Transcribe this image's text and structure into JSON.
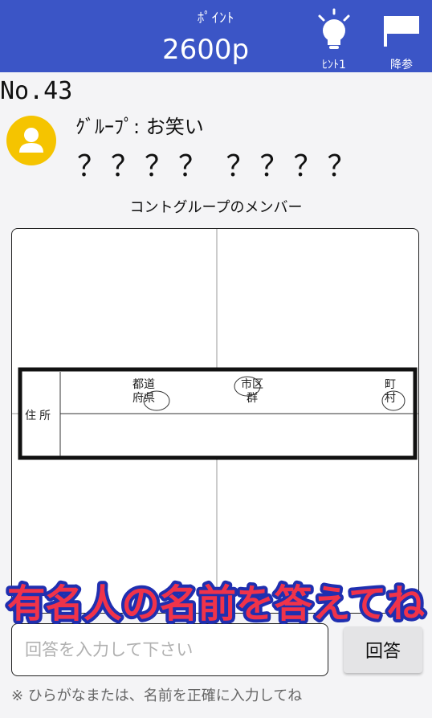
{
  "header": {
    "points_label": "ﾎﾟｲﾝﾄ",
    "points_value": "2600p",
    "hint_label": "ﾋﾝﾄ1",
    "giveup_label": "降参"
  },
  "question": {
    "number": "No.43",
    "group": "ｸﾞﾙｰﾌﾟ: お笑い",
    "masked_name": "？？？？ ？？？？",
    "caption": "コントグループのメンバー"
  },
  "board": {
    "row_label": "住所",
    "prefecture": [
      "都道",
      "府県"
    ],
    "city": [
      "市区",
      "群"
    ],
    "town": [
      "町",
      "村"
    ]
  },
  "banner_text": "有名人の名前を答えてね",
  "answer": {
    "placeholder": "回答を入力して下さい",
    "value": "",
    "submit_label": "回答"
  },
  "note": "※ ひらがなまたは、名前を正確に入力してね"
}
